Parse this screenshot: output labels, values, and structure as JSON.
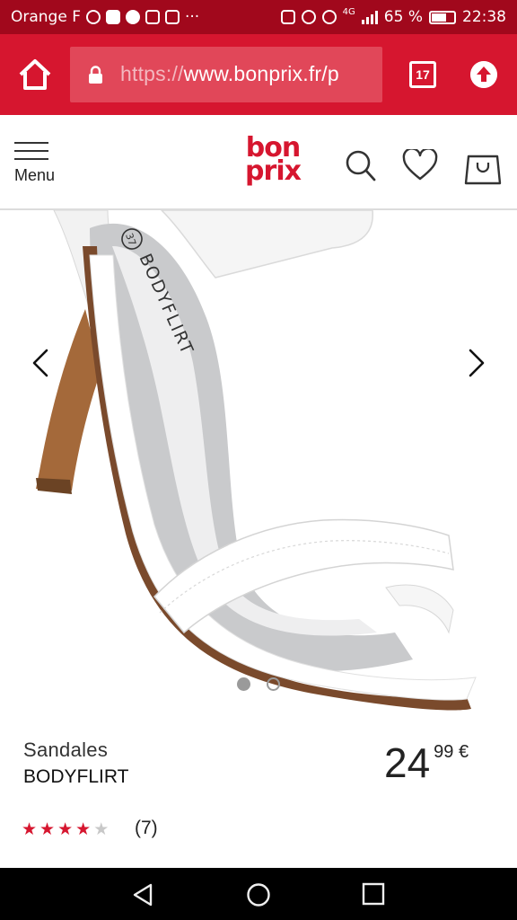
{
  "status_bar": {
    "carrier": "Orange F",
    "battery": "65 %",
    "network": "4G",
    "time": "22:38"
  },
  "browser": {
    "url_protocol": "https://",
    "url_rest": "www.bonprix.fr/p",
    "tab_count": "17"
  },
  "header": {
    "menu_label": "Menu",
    "logo_line1": "bon",
    "logo_line2": "prix"
  },
  "gallery": {
    "image_count": 2,
    "active_index": 0,
    "insole_print": "BODYFLIRT",
    "size_mark": "37"
  },
  "product": {
    "name": "Sandales",
    "brand": "BODYFLIRT",
    "price_int": "24",
    "price_dec": "99 €",
    "rating": 4,
    "rating_max": 5,
    "review_count": "(7)"
  },
  "colors": {
    "brand_red": "#d6162f",
    "status_red": "#a1081c"
  }
}
